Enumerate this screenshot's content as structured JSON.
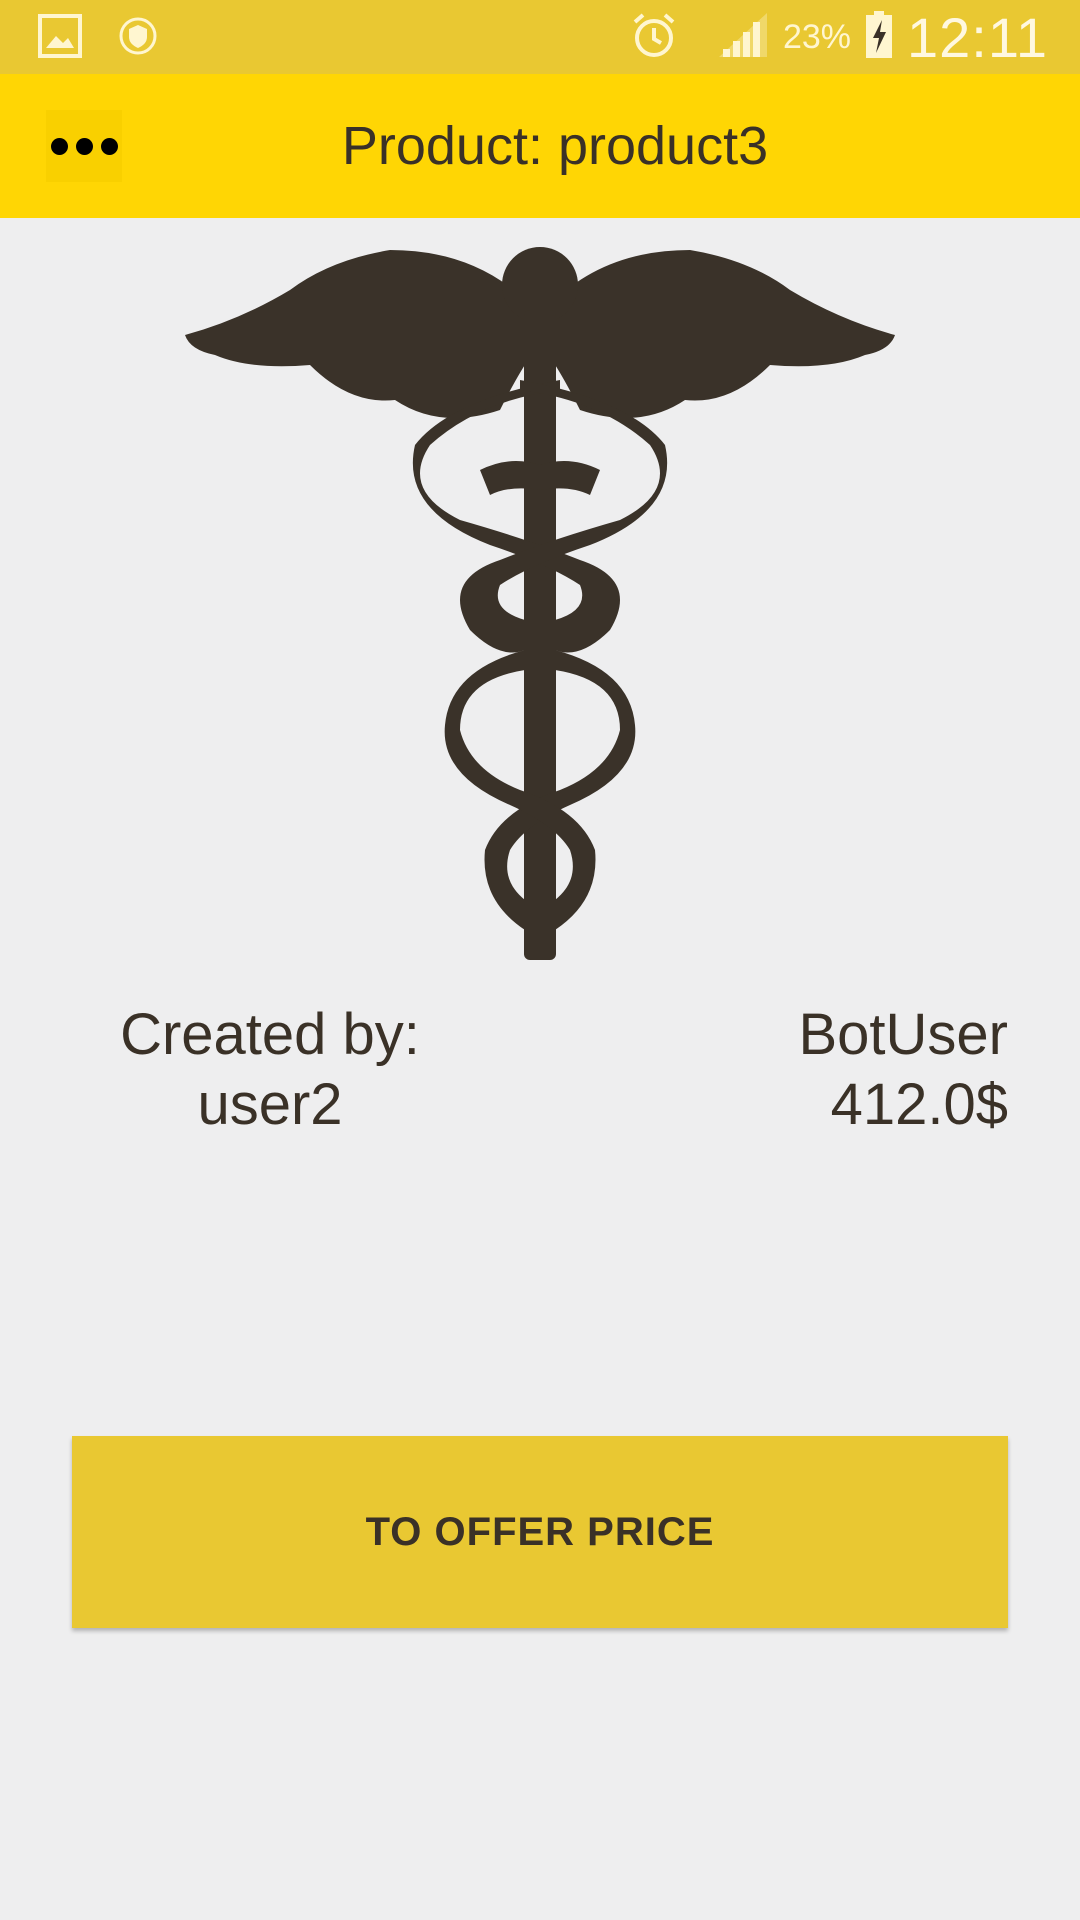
{
  "status_bar": {
    "icons_left": [
      "gallery-icon",
      "shield-icon"
    ],
    "icons_right": [
      "alarm-icon",
      "signal-icon",
      "battery-charging-icon"
    ],
    "battery_percent": "23%",
    "time": "12:11"
  },
  "app_bar": {
    "menu_icon": "more-horizontal-icon",
    "title": "Product: product3"
  },
  "product": {
    "image_icon": "caduceus-icon",
    "created_by_label": "Created by:",
    "creator": "user2",
    "owner": "BotUser",
    "price": "412.0$"
  },
  "actions": {
    "offer_button_label": "TO OFFER PRICE"
  },
  "colors": {
    "status_bar_bg": "#E9C832",
    "app_bar_bg": "#FFD604",
    "page_bg": "#EEEEEF",
    "button_bg": "#E9C832",
    "text": "#3A3127",
    "symbol": "#3A3229"
  }
}
